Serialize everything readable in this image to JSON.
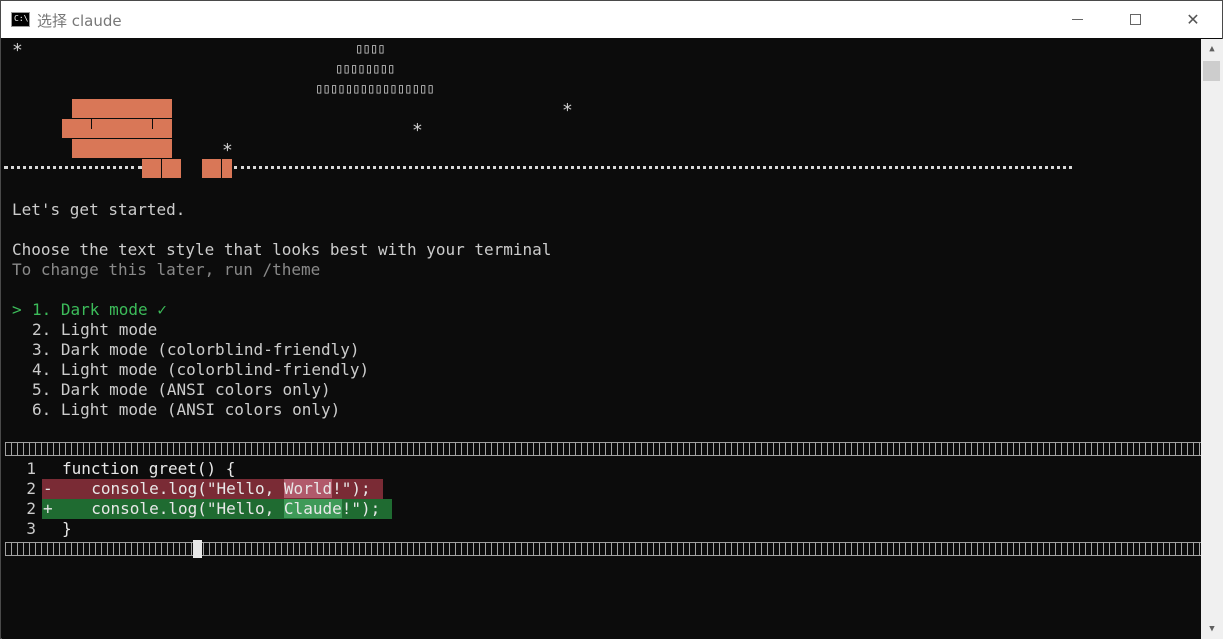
{
  "window": {
    "title": "选择 claude",
    "icon_label": "C:\\",
    "minimize_icon": "minimize-icon",
    "maximize_icon": "maximize-icon",
    "close_label": "✕"
  },
  "banner": {
    "stars": [
      "*",
      "*",
      "*",
      "*"
    ],
    "boxes_row1": "▯▯▯▯",
    "boxes_row2": "▯▯▯▯▯▯▯▯",
    "boxes_row3": "▯▯▯▯▯▯▯▯▯▯▯▯▯▯▯▯",
    "brand_color": "#d97757"
  },
  "intro": {
    "greeting": "Let's get started.",
    "prompt": "Choose the text style that looks best with your terminal",
    "hint": "To change this later, run /theme"
  },
  "options": [
    {
      "text": "1. Dark mode ✓",
      "selected": true
    },
    {
      "text": "2. Light mode",
      "selected": false
    },
    {
      "text": "3. Dark mode (colorblind-friendly)",
      "selected": false
    },
    {
      "text": "4. Light mode (colorblind-friendly)",
      "selected": false
    },
    {
      "text": "5. Dark mode (ANSI colors only)",
      "selected": false
    },
    {
      "text": "6. Light mode (ANSI colors only)",
      "selected": false
    }
  ],
  "selector_glyph": ">",
  "diff_preview": {
    "lines": [
      {
        "num": "1",
        "marker": "",
        "code": "function greet() {"
      },
      {
        "num": "2",
        "marker": "-",
        "pre": "  console.log(\"Hello, ",
        "hl": "World",
        "post": "!\");"
      },
      {
        "num": "2",
        "marker": "+",
        "pre": "  console.log(\"Hello, ",
        "hl": "Claude",
        "post": "!\");"
      },
      {
        "num": "3",
        "marker": "",
        "code": "}"
      }
    ],
    "colors": {
      "removed": "#7a2b35",
      "added": "#1f6b31",
      "selected_option": "#3cbc5a"
    }
  },
  "scrollbar": {
    "up_icon": "▲",
    "down_icon": "▼"
  }
}
